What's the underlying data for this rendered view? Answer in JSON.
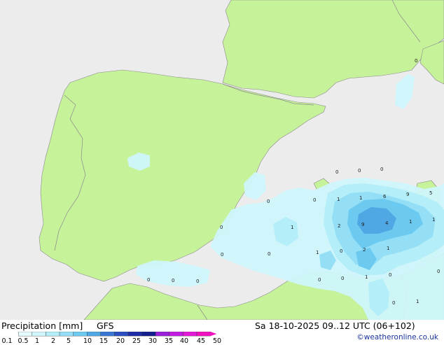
{
  "map": {
    "land_color": "#c6f29a",
    "sea_color": "#ececec",
    "border_color": "#8a8a8a",
    "precip_colors": [
      "#cff6fb",
      "#b4eef8",
      "#94dff5",
      "#6ccaf0",
      "#4fa8e3"
    ],
    "point_values": [
      {
        "label": "0"
      },
      {
        "label": "0"
      },
      {
        "label": "0"
      },
      {
        "label": "0"
      },
      {
        "label": "0"
      },
      {
        "label": "0"
      },
      {
        "label": "1"
      },
      {
        "label": "1"
      },
      {
        "label": "6"
      },
      {
        "label": "9"
      },
      {
        "label": "5"
      },
      {
        "label": "1"
      },
      {
        "label": "2"
      },
      {
        "label": "9"
      },
      {
        "label": "4"
      },
      {
        "label": "1"
      },
      {
        "label": "1"
      },
      {
        "label": "0"
      },
      {
        "label": "1"
      },
      {
        "label": "0"
      },
      {
        "label": "2"
      },
      {
        "label": "1"
      },
      {
        "label": "0"
      },
      {
        "label": "0"
      },
      {
        "label": "0"
      },
      {
        "label": "0"
      },
      {
        "label": "0"
      },
      {
        "label": "0"
      },
      {
        "label": "1"
      },
      {
        "label": "0"
      },
      {
        "label": "0"
      },
      {
        "label": "1"
      },
      {
        "label": "0"
      },
      {
        "label": "0"
      }
    ]
  },
  "footer": {
    "title": "Precipitation [mm]",
    "model": "GFS",
    "datetime": "Sa 18-10-2025 09..12 UTC (06+102)",
    "credit": "©weatheronline.co.uk"
  },
  "legend": {
    "ticks": [
      "0.1",
      "0.5",
      "1",
      "2",
      "5",
      "10",
      "15",
      "20",
      "25",
      "30",
      "35",
      "40",
      "45",
      "50"
    ],
    "colors": [
      "#e6fbfd",
      "#cff6fb",
      "#b4eef8",
      "#94dff5",
      "#6ccaf0",
      "#4fa8e3",
      "#3a78d4",
      "#2c4fc0",
      "#1d2da6",
      "#141f8c",
      "#9a1fd8",
      "#c11de0",
      "#e21ad6",
      "#f012bf"
    ]
  }
}
